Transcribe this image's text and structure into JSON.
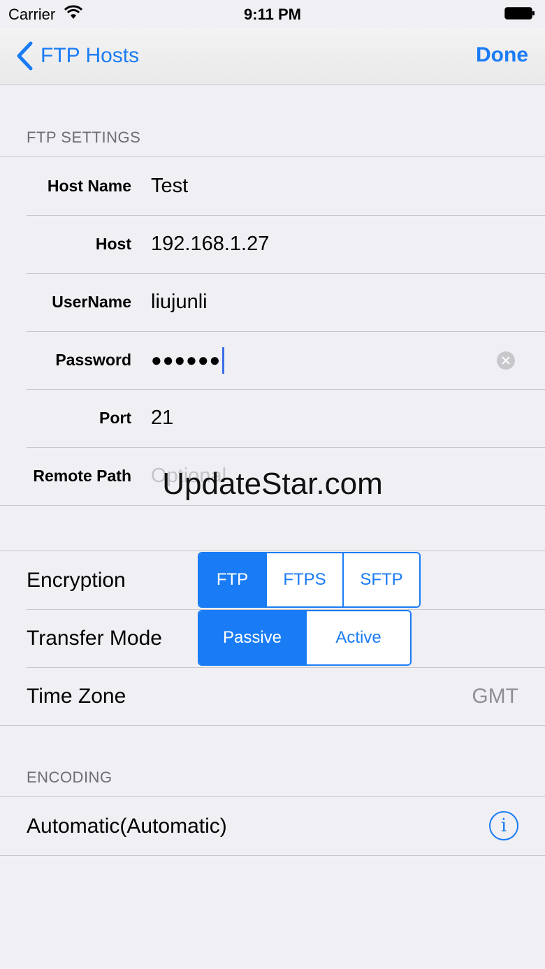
{
  "status_bar": {
    "carrier": "Carrier",
    "time": "9:11 PM"
  },
  "nav": {
    "back_label": "FTP Hosts",
    "done_label": "Done"
  },
  "ftp_settings": {
    "header": "FTP SETTINGS",
    "fields": [
      {
        "label": "Host Name",
        "value": "Test"
      },
      {
        "label": "Host",
        "value": "192.168.1.27"
      },
      {
        "label": "UserName",
        "value": "liujunli"
      },
      {
        "label": "Password",
        "value": "●●●●●●"
      },
      {
        "label": "Port",
        "value": "21"
      },
      {
        "label": "Remote Path",
        "value": "",
        "placeholder": "Optional"
      }
    ]
  },
  "options": {
    "encryption": {
      "label": "Encryption",
      "segments": [
        "FTP",
        "FTPS",
        "SFTP"
      ],
      "selected": "FTP"
    },
    "transfer_mode": {
      "label": "Transfer Mode",
      "segments": [
        "Passive",
        "Active"
      ],
      "selected": "Passive"
    },
    "time_zone": {
      "label": "Time Zone",
      "value": "GMT"
    }
  },
  "encoding": {
    "header": "ENCODING",
    "value": "Automatic(Automatic)"
  },
  "watermark": "UpdateStar.com",
  "colors": {
    "accent": "#1a7cf5",
    "background": "#efeff4",
    "separator": "#c8c7cc"
  }
}
